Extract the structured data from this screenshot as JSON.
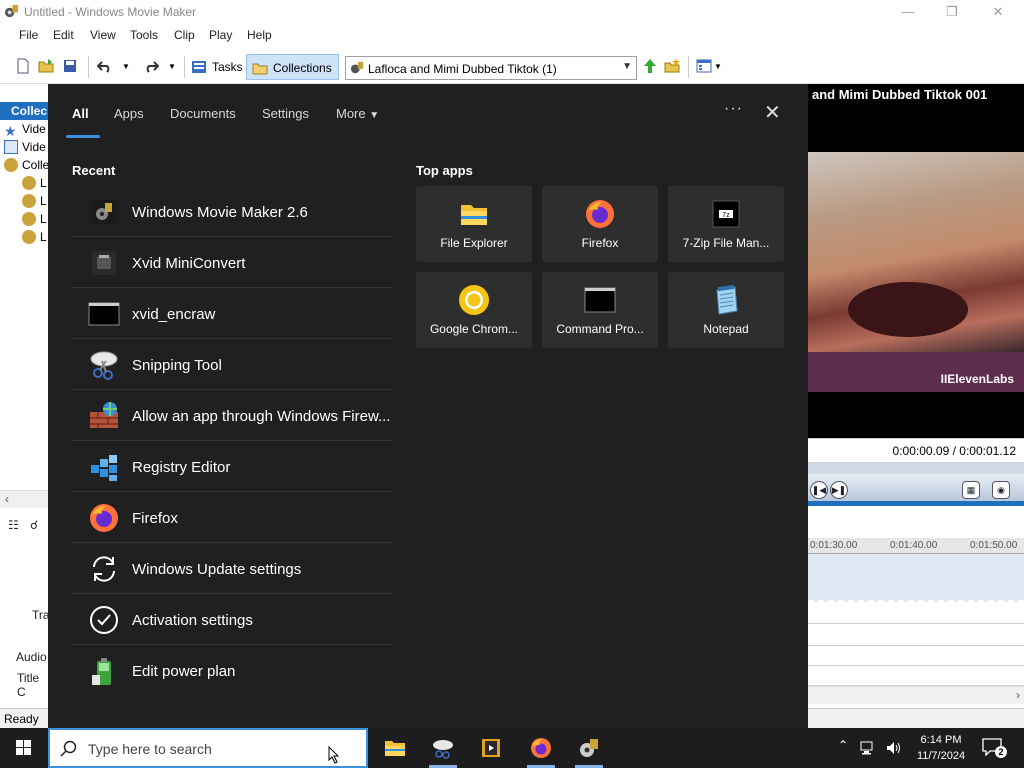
{
  "window": {
    "title": "Untitled - Windows Movie Maker",
    "menu": [
      "File",
      "Edit",
      "View",
      "Tools",
      "Clip",
      "Play",
      "Help"
    ],
    "toolbar": {
      "tasks_label": "Tasks",
      "collections_label": "Collections",
      "collection_selected": "Lafloca and Mimi Dubbed Tiktok (1)"
    },
    "collections_pane": {
      "header": "Collec",
      "items": [
        "Vide",
        "Vide",
        "Colle",
        "L",
        "L",
        "L",
        "L"
      ]
    },
    "storyboard": {
      "track_label": "Tra",
      "audio_label": "Audio",
      "title_label": "Title C"
    },
    "status": "Ready",
    "preview": {
      "clip_title": "and Mimi Dubbed Tiktok 001",
      "timecode": "0:00:00.09 / 0:00:01.12",
      "watermark": "IIElevenLabs"
    },
    "timeline": {
      "ticks": [
        "0:01:30.00",
        "0:01:40.00",
        "0:01:50.00"
      ]
    }
  },
  "flyout": {
    "tabs": [
      "All",
      "Apps",
      "Documents",
      "Settings",
      "More"
    ],
    "recent_title": "Recent",
    "top_apps_title": "Top apps",
    "recent": [
      {
        "label": "Windows Movie Maker 2.6",
        "icon": "movie-maker-icon"
      },
      {
        "label": "Xvid MiniConvert",
        "icon": "xvid-icon"
      },
      {
        "label": "xvid_encraw",
        "icon": "console-icon"
      },
      {
        "label": "Snipping Tool",
        "icon": "scissors-icon"
      },
      {
        "label": "Allow an app through Windows Firew...",
        "icon": "firewall-icon"
      },
      {
        "label": "Registry Editor",
        "icon": "registry-icon"
      },
      {
        "label": "Firefox",
        "icon": "firefox-icon"
      },
      {
        "label": "Windows Update settings",
        "icon": "update-icon"
      },
      {
        "label": "Activation settings",
        "icon": "checkmark-icon"
      },
      {
        "label": "Edit power plan",
        "icon": "battery-icon"
      }
    ],
    "top_apps": [
      {
        "label": "File Explorer",
        "icon": "folder-icon"
      },
      {
        "label": "Firefox",
        "icon": "firefox-icon"
      },
      {
        "label": "7-Zip File Man...",
        "icon": "7zip-icon"
      },
      {
        "label": "Google Chrom...",
        "icon": "chrome-icon"
      },
      {
        "label": "Command Pro...",
        "icon": "console-icon"
      },
      {
        "label": "Notepad",
        "icon": "notepad-icon"
      }
    ]
  },
  "taskbar": {
    "search_placeholder": "Type here to search",
    "time": "6:14 PM",
    "date": "11/7/2024",
    "notification_count": "2"
  },
  "colors": {
    "accent": "#3d8fe0",
    "flyout_bg": "#202020",
    "tile_bg": "#2e2e2e",
    "taskbar_bg": "#1d1d1d"
  }
}
